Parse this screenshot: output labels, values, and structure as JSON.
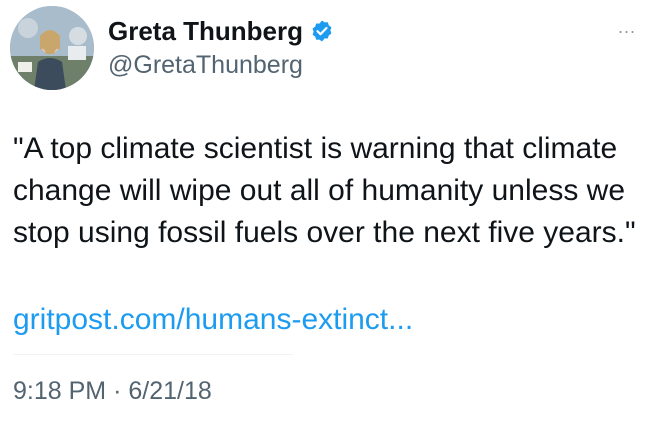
{
  "author": {
    "display_name": "Greta Thunberg",
    "handle": "@GretaThunberg",
    "verified": true,
    "avatar_icon": "profile-photo"
  },
  "more_icon": "ellipsis-icon",
  "more_label": "...",
  "tweet": {
    "text": "\"A top climate scientist is warning that climate change will wipe out all of humanity unless we stop using fossil fuels over the next five years.\"",
    "link": "gritpost.com/humans-extinct...",
    "time": "9:18 PM",
    "separator": "·",
    "date": "6/21/18"
  },
  "colors": {
    "text": "#0f1419",
    "secondary": "#536471",
    "link": "#1d9bf0",
    "verified": "#1d9bf0"
  }
}
